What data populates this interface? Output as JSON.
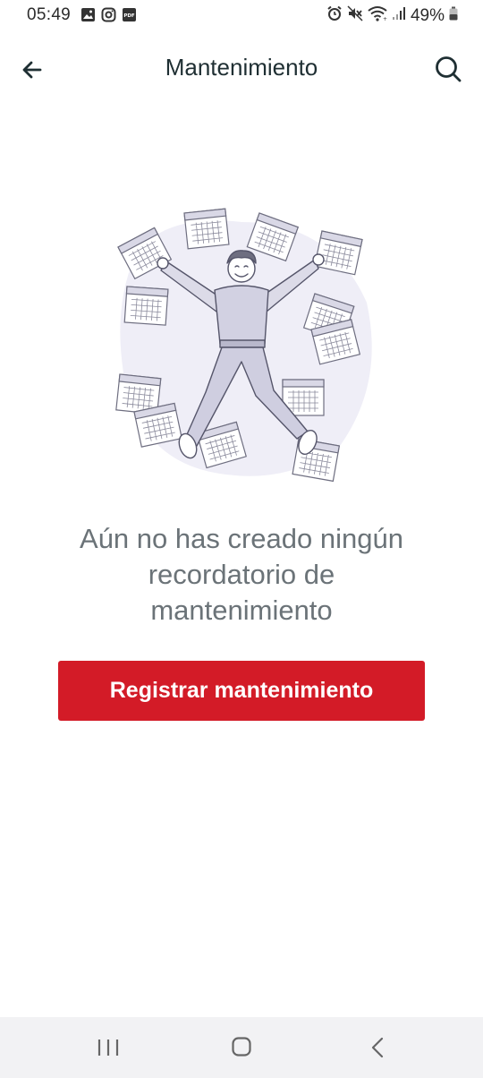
{
  "status_bar": {
    "time": "05:49",
    "battery": "49%",
    "icons_left": [
      "gallery-icon",
      "instagram-icon",
      "pdf-icon"
    ],
    "icons_right": [
      "alarm-icon",
      "mute-icon",
      "wifi-icon",
      "signal-icon",
      "battery-icon"
    ]
  },
  "app_bar": {
    "title": "Mantenimiento",
    "back_icon": "arrow-left-icon",
    "search_icon": "search-icon"
  },
  "empty_state": {
    "illustration": "person-with-calendars-illustration",
    "message": "Aún no has creado ningún recordatorio de mantenimiento",
    "button_label": "Registrar mantenimiento",
    "button_color": "#d31b27"
  },
  "nav_bar": {
    "items": [
      "recents-icon",
      "home-icon",
      "back-icon"
    ]
  }
}
